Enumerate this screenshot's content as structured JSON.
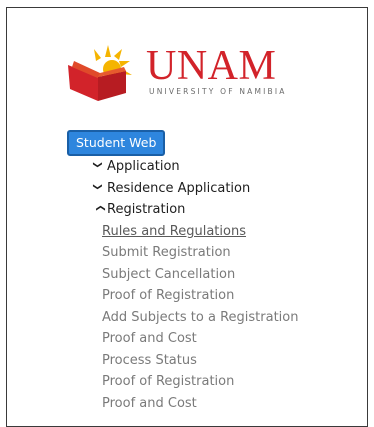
{
  "logo": {
    "name": "UNAM",
    "subtitle": "UNIVERSITY OF NAMIBIA"
  },
  "student_web_label": "Student Web",
  "tree": [
    {
      "label": "Application",
      "expanded": false
    },
    {
      "label": "Residence Application",
      "expanded": false
    },
    {
      "label": "Registration",
      "expanded": true
    }
  ],
  "registration_items": [
    {
      "label": "Rules and Regulations",
      "active": true
    },
    {
      "label": "Submit Registration",
      "active": false
    },
    {
      "label": "Subject Cancellation",
      "active": false
    },
    {
      "label": "Proof of Registration",
      "active": false
    },
    {
      "label": "Add Subjects to a Registration",
      "active": false
    },
    {
      "label": "Proof and Cost",
      "active": false
    },
    {
      "label": "Process Status",
      "active": false
    },
    {
      "label": "Proof of Registration",
      "active": false
    },
    {
      "label": "Proof and Cost",
      "active": false
    }
  ],
  "colors": {
    "brand_red": "#d2232a",
    "brand_yellow": "#f5b400",
    "button_blue": "#2e86de"
  }
}
